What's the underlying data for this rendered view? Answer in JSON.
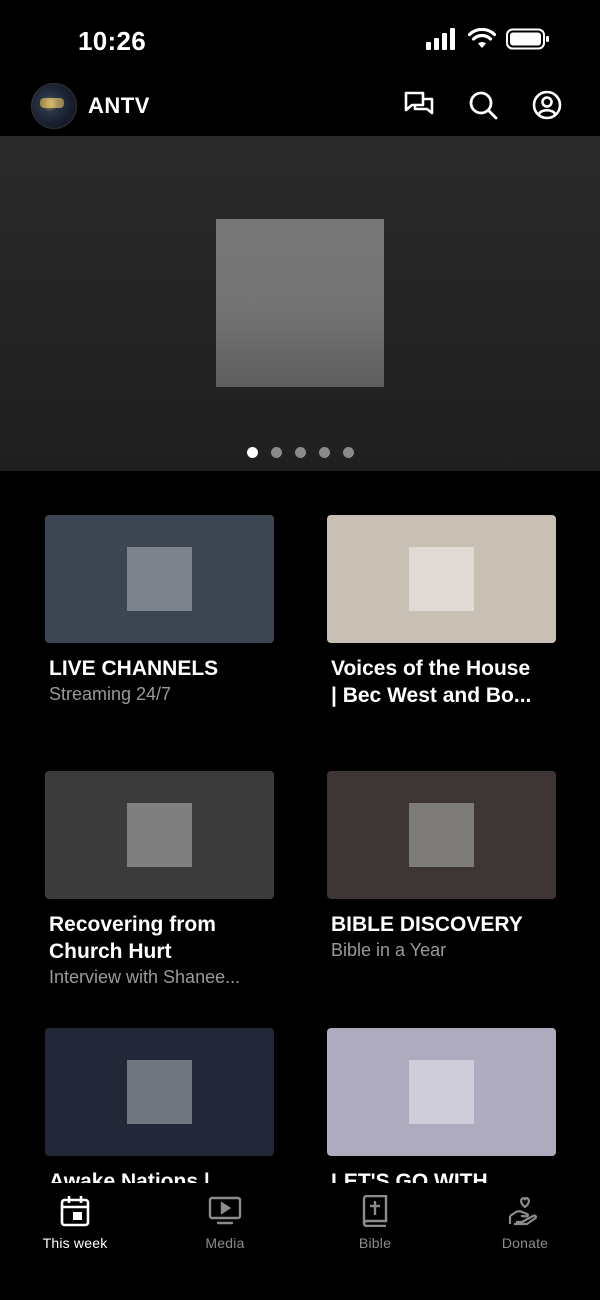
{
  "status_bar": {
    "time": "10:26"
  },
  "header": {
    "title": "ANTV",
    "icons": [
      "chat-icon",
      "search-icon",
      "account-icon"
    ]
  },
  "hero": {
    "dot_count": 5,
    "active_dot": 0
  },
  "cards": [
    {
      "title": "LIVE CHANNELS",
      "title2": "",
      "subtitle": "Streaming 24/7",
      "thumb_color": "#3c4653",
      "inner_color": "#7c838c"
    },
    {
      "title": "Voices of the House",
      "title2": "| Bec West and Bo...",
      "subtitle": "",
      "thumb_color": "#c9c0b5",
      "inner_color": "#dfdad4"
    },
    {
      "title": "Recovering from",
      "title2": "Church Hurt",
      "subtitle": "Interview with Shanee...",
      "thumb_color": "#3b3b3b",
      "inner_color": "#7f7f7f"
    },
    {
      "title": "BIBLE DISCOVERY",
      "title2": "",
      "subtitle": "Bible in a Year",
      "thumb_color": "#3d3634",
      "inner_color": "#7e7c7a"
    },
    {
      "title": "Awake Nations |",
      "title2": "",
      "subtitle": "",
      "thumb_color": "#232838",
      "inner_color": "#717580"
    },
    {
      "title": "LET'S GO WITH",
      "title2": "",
      "subtitle": "",
      "thumb_color": "#aeabbf",
      "inner_color": "#cfcdd9"
    }
  ],
  "tabs": [
    {
      "label": "This week",
      "icon": "calendar-icon",
      "active": true
    },
    {
      "label": "Media",
      "icon": "tv-play-icon",
      "active": false
    },
    {
      "label": "Bible",
      "icon": "bible-icon",
      "active": false
    },
    {
      "label": "Donate",
      "icon": "donate-heart-hand-icon",
      "active": false
    }
  ],
  "colors": {
    "background": "#000000",
    "hero_bg": "#252525",
    "inactive_tab": "#8c8c8c",
    "subtitle": "#9a9a9a"
  }
}
